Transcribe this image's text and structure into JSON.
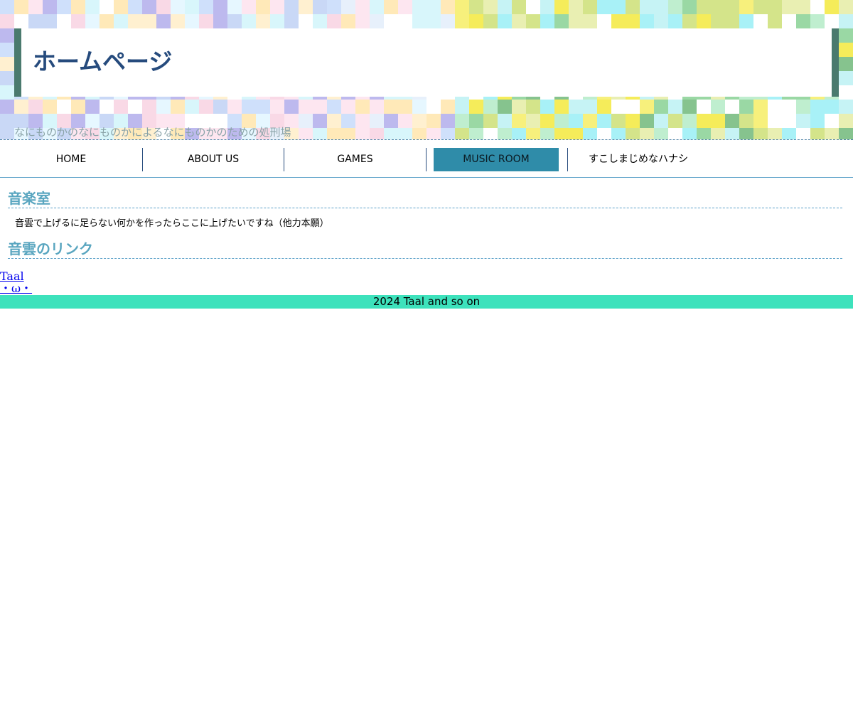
{
  "header": {
    "title": "ホームページ",
    "tagline": "なにものかのなにものかによるなにものかのための処刑場",
    "colors": {
      "title_text": "#264b7d",
      "title_box_border": "#4a7a6e",
      "tagline_text": "#8aa3a8"
    }
  },
  "nav": {
    "items": [
      {
        "label": "HOME"
      },
      {
        "label": "ABOUT US"
      },
      {
        "label": "GAMES"
      },
      {
        "label": "MUSIC ROOM",
        "active": true
      },
      {
        "label": "すこしまじめなハナシ"
      }
    ],
    "active_color": "#2f8ca9"
  },
  "main": {
    "section1": {
      "heading": "音楽室",
      "text": "音雲で上げるに足らない何かを作ったらここに上げたいですね（他力本願）"
    },
    "section2": {
      "heading": "音雲のリンク",
      "links": [
        "Taal",
        "・ω・"
      ]
    },
    "heading_color": "#5aa6c0"
  },
  "footer": {
    "text": "2024 Taal and so on",
    "background": "#3de2bc"
  }
}
